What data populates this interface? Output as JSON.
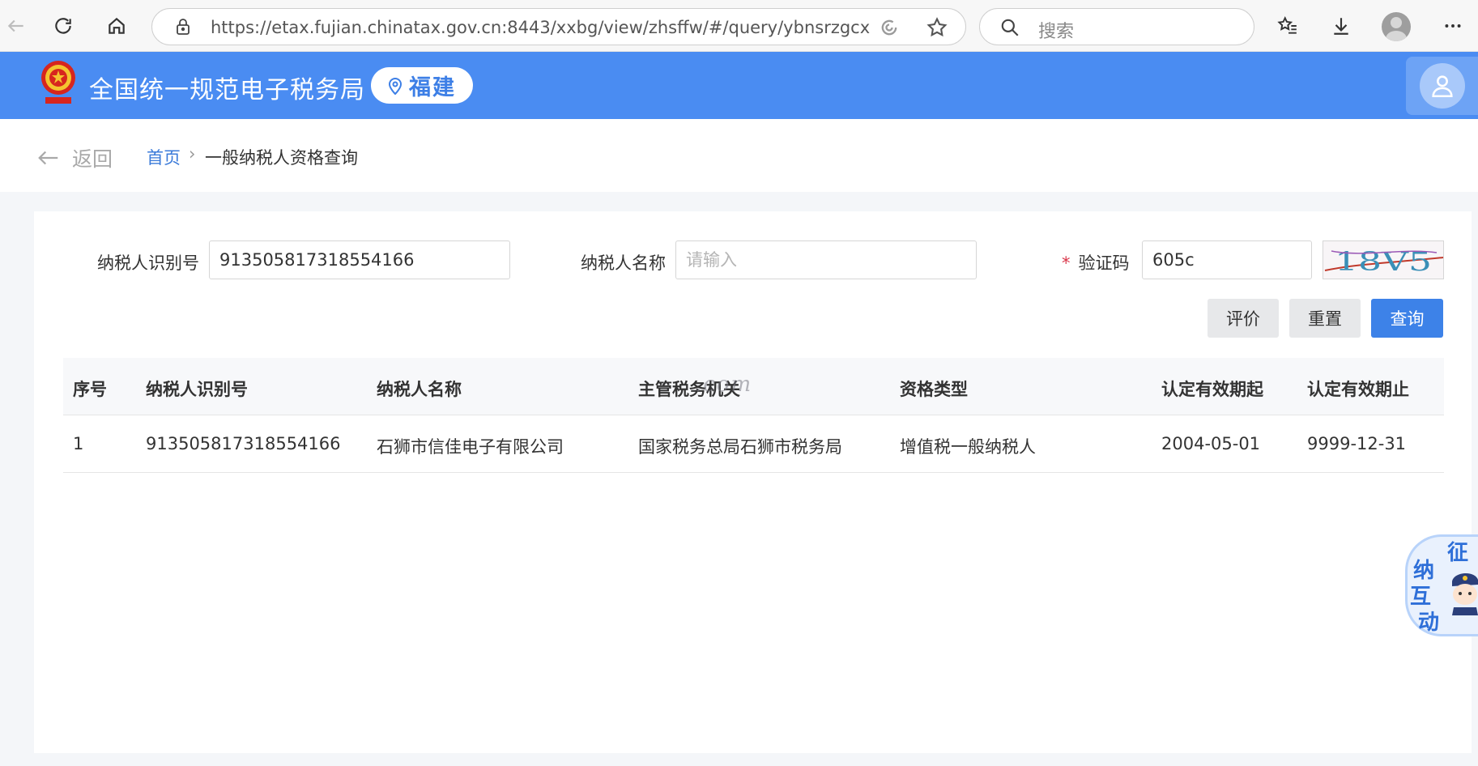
{
  "browser": {
    "url": "https://etax.fujian.chinatax.gov.cn:8443/xxbg/view/zhsffw/#/query/ybnsrzgcx",
    "search_placeholder": "搜索"
  },
  "header": {
    "site_title": "全国统一规范电子税务局",
    "region": "福建"
  },
  "breadcrumb": {
    "back_label": "返回",
    "home": "首页",
    "separator": "›",
    "current": "一般纳税人资格查询"
  },
  "form": {
    "taxpayer_id_label": "纳税人识别号",
    "taxpayer_id_value": "913505817318554166",
    "taxpayer_name_label": "纳税人名称",
    "taxpayer_name_placeholder": "请输入",
    "captcha_required_mark": "*",
    "captcha_label": "验证码",
    "captcha_value": "605c",
    "captcha_image_text": "18V5",
    "buttons": {
      "evaluate": "评价",
      "reset": "重置",
      "query": "查询"
    }
  },
  "table": {
    "columns": [
      "序号",
      "纳税人识别号",
      "纳税人名称",
      "主管税务机关",
      "资格类型",
      "认定有效期起",
      "认定有效期止"
    ],
    "rows": [
      [
        "1",
        "913505817318554166",
        "石狮市信佳电子有限公司",
        "国家税务总局石狮市税务局",
        "增值税一般纳税人",
        "2004-05-01",
        "9999-12-31"
      ]
    ]
  },
  "watermark": ".com",
  "assistant": {
    "chars": [
      "征",
      "纳",
      "互",
      "动"
    ]
  },
  "colors": {
    "header_blue": "#4a8cf2",
    "primary_button": "#3d82e8",
    "link": "#3a7ad9",
    "required": "#d9364a"
  }
}
